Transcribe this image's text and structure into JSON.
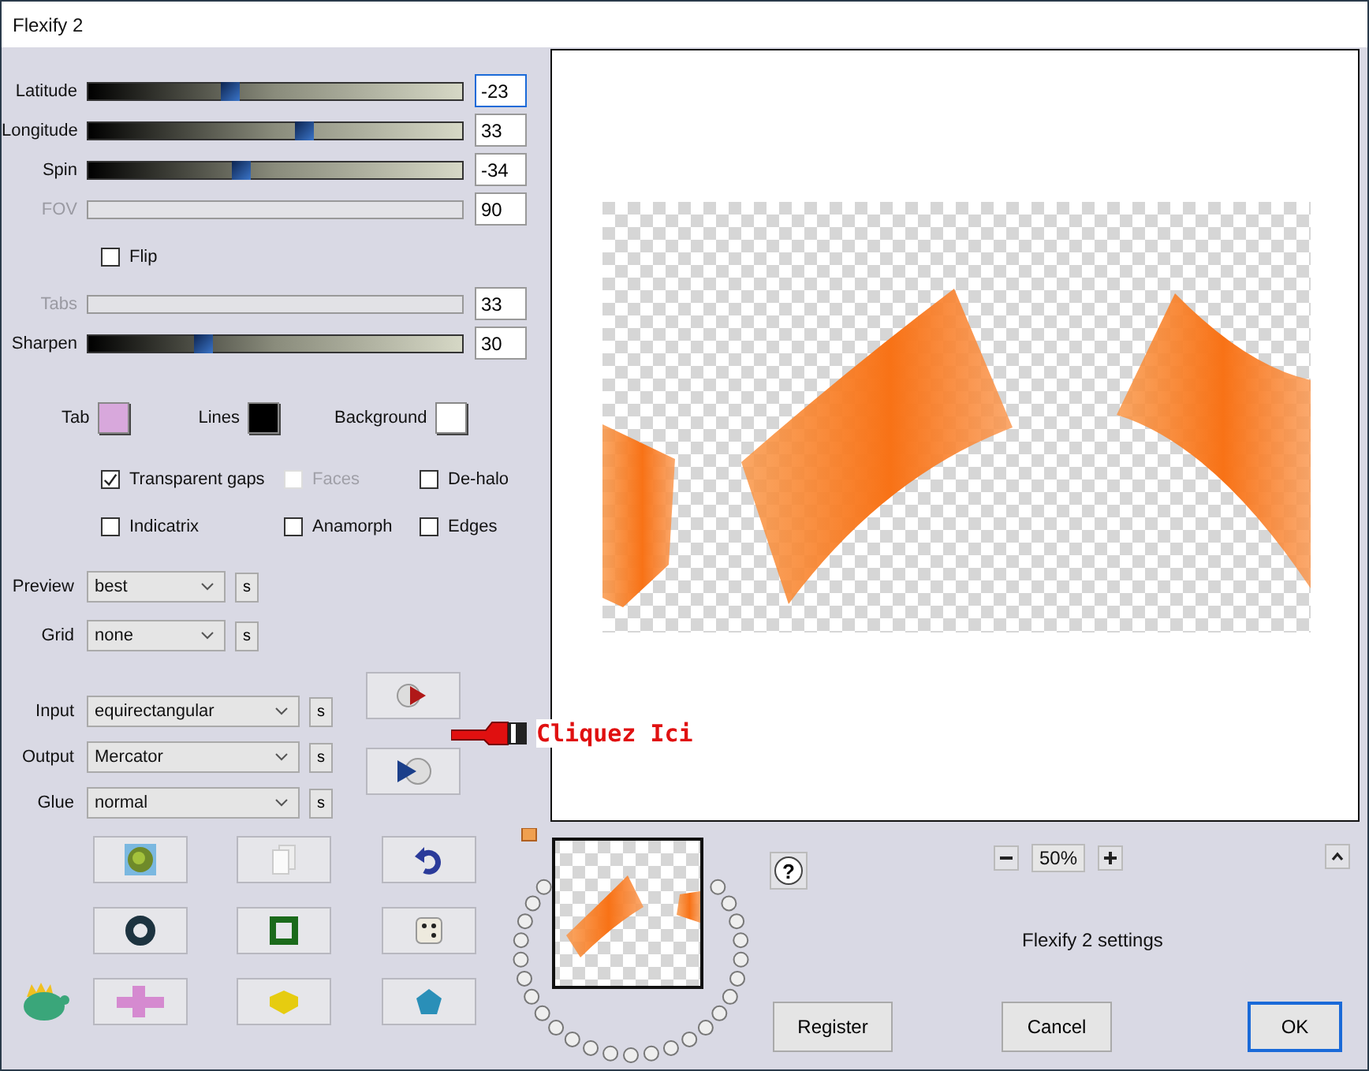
{
  "window": {
    "title": "Flexify 2"
  },
  "sliders": [
    {
      "label": "Latitude",
      "value": "-23",
      "disabled": false,
      "focused": true,
      "level": 0.38
    },
    {
      "label": "Longitude",
      "value": "33",
      "disabled": false,
      "focused": false,
      "level": 0.58
    },
    {
      "label": "Spin",
      "value": "-34",
      "disabled": false,
      "focused": false,
      "level": 0.41
    },
    {
      "label": "FOV",
      "value": "90",
      "disabled": true,
      "focused": false
    },
    {
      "label": "Tabs",
      "value": "33",
      "disabled": true,
      "focused": false
    },
    {
      "label": "Sharpen",
      "value": "30",
      "disabled": false,
      "focused": false,
      "level": 0.31
    }
  ],
  "flip": {
    "label": "Flip",
    "checked": false
  },
  "colors": [
    {
      "label": "Tab",
      "color": "#d8a8dc"
    },
    {
      "label": "Lines",
      "color": "#000000"
    },
    {
      "label": "Background",
      "color": "#ffffff"
    }
  ],
  "checkboxes": [
    {
      "label": "Transparent gaps",
      "checked": true,
      "disabled": false
    },
    {
      "label": "Faces",
      "checked": false,
      "disabled": true
    },
    {
      "label": "De-halo",
      "checked": false,
      "disabled": false
    },
    {
      "label": "Indicatrix",
      "checked": false,
      "disabled": false
    },
    {
      "label": "Anamorph",
      "checked": false,
      "disabled": false
    },
    {
      "label": "Edges",
      "checked": false,
      "disabled": false
    }
  ],
  "view_dropdowns": [
    {
      "label": "Preview",
      "value": "best",
      "s": "s"
    },
    {
      "label": "Grid",
      "value": "none",
      "s": "s"
    }
  ],
  "mapping_dropdowns": [
    {
      "label": "Input",
      "value": "equirectangular",
      "s": "s"
    },
    {
      "label": "Output",
      "value": "Mercator",
      "s": "s"
    },
    {
      "label": "Glue",
      "value": "normal",
      "s": "s"
    }
  ],
  "annotation": {
    "text": "Cliquez Ici"
  },
  "help": "?",
  "zoom": {
    "value": "50%"
  },
  "settings_label": "Flexify 2 settings",
  "buttons": [
    {
      "label": "Register",
      "default": false
    },
    {
      "label": "Cancel",
      "default": false
    },
    {
      "label": "OK",
      "default": true
    }
  ]
}
